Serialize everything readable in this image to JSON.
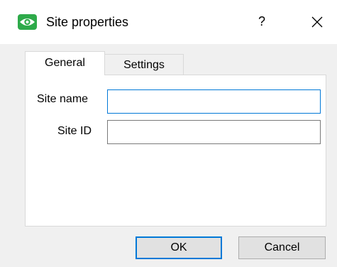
{
  "window": {
    "title": "Site properties",
    "help_label": "?",
    "app_icon": "eye-icon",
    "close_icon": "close-icon"
  },
  "tabs": [
    {
      "label": "General",
      "active": true
    },
    {
      "label": "Settings",
      "active": false
    }
  ],
  "form": {
    "site_name": {
      "label": "Site name",
      "value": "",
      "placeholder": ""
    },
    "site_id": {
      "label": "Site ID",
      "value": "",
      "placeholder": ""
    }
  },
  "buttons": {
    "ok_label": "OK",
    "cancel_label": "Cancel"
  },
  "colors": {
    "accent": "#0078d7",
    "app_icon_bg": "#2eaa4a",
    "dialog_bg": "#f0f0f0"
  }
}
